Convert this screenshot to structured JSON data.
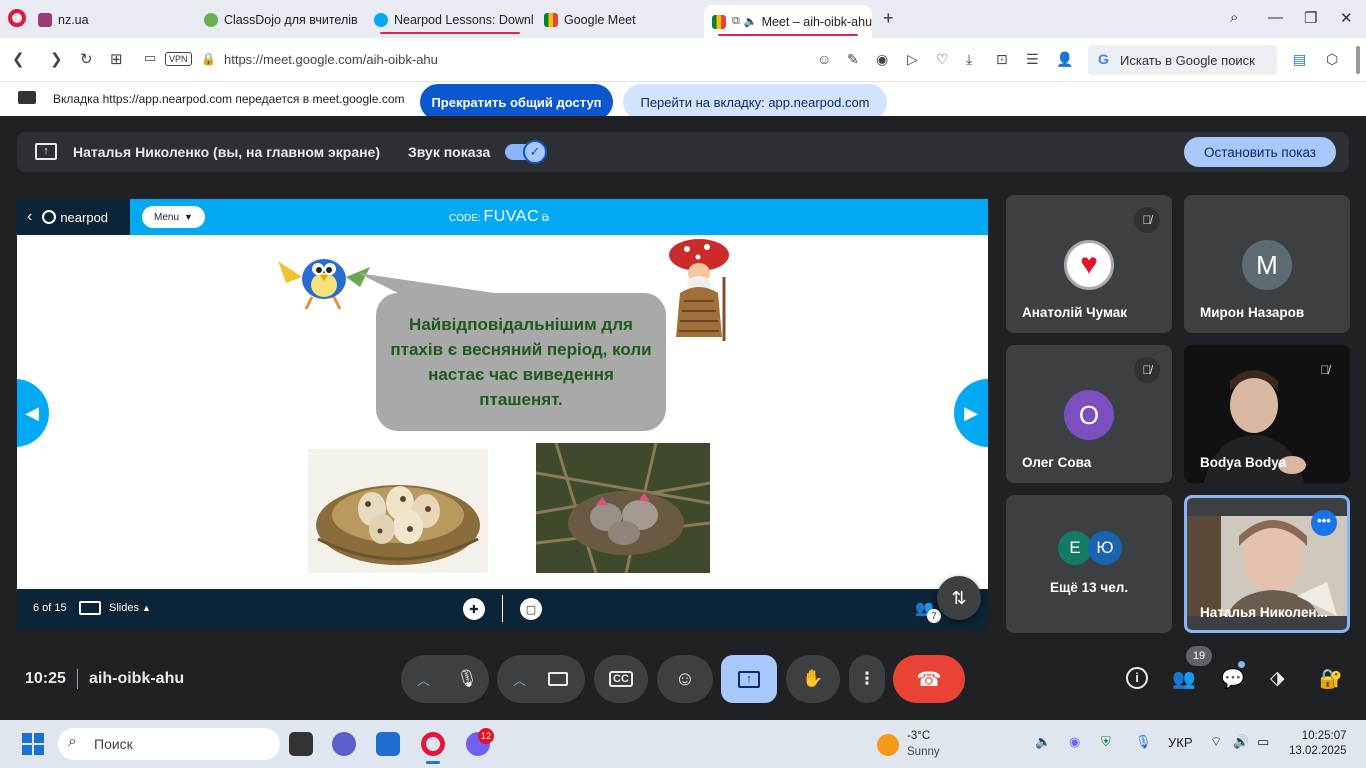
{
  "browser": {
    "tabs": [
      {
        "title": "nz.ua",
        "icon": "nzua-icon"
      },
      {
        "title": "ClassDojo для вчителів",
        "icon": "classdojo-icon"
      },
      {
        "title": "Nearpod Lessons: Downlo",
        "icon": "nearpod-icon"
      },
      {
        "title": "Google Meet",
        "icon": "google-meet-icon"
      },
      {
        "title": "Meet – aih-oibk-ahu",
        "icon": "google-meet-icon"
      }
    ],
    "address": "https://meet.google.com/aih-oibk-ahu",
    "vpn_label": "VPN",
    "search_box": "Искать в Google поиск",
    "share_message": "Вкладка https://app.nearpod.com передается в meet.google.com",
    "stop_sharing_label": "Прекратить общий доступ",
    "go_to_tab_label": "Перейти на вкладку: app.nearpod.com"
  },
  "presentation_bar": {
    "presenter": "Наталья Николенко (вы, на главном экране)",
    "sound_label": "Звук показа",
    "sound_on": true,
    "stop_label": "Остановить показ"
  },
  "nearpod": {
    "brand": "nearpod",
    "menu_label": "Menu",
    "code_prefix": "CODE:",
    "code": "FUVAC",
    "slide_text": "Найвідповідальнішим для птахів є весняний період, коли настає час виведення пташенят.",
    "slide_counter": "6 of 15",
    "slides_label": "Slides",
    "participants_badge": "7",
    "accent": "#03a9f4",
    "dark": "#0b2438"
  },
  "participants": [
    {
      "name": "Анатолій Чумак",
      "avatar": "heart-logo",
      "muted": true
    },
    {
      "name": "Мирон Назаров",
      "initial": "M",
      "color": "#5f6b73",
      "muted": false
    },
    {
      "name": "Олег Сова",
      "initial": "O",
      "color": "#7b4fbf",
      "muted": true
    },
    {
      "name": "Bodya Bodya",
      "video": true,
      "muted": true
    },
    {
      "more_label": "Ещё 13 чел.",
      "initials": [
        "Е",
        "Ю"
      ],
      "colors": [
        "#137a63",
        "#1a63b0"
      ]
    },
    {
      "name": "Наталья Николен...",
      "video": true,
      "self": true
    }
  ],
  "controls": {
    "time": "10:25",
    "meeting_code": "aih-oibk-ahu",
    "participant_count": "19"
  },
  "taskbar": {
    "search_placeholder": "Поиск",
    "weather_temp": "-3°C",
    "weather_desc": "Sunny",
    "viber_badge": "12",
    "language": "УКР",
    "clock_time": "10:25:07",
    "clock_date": "13.02.2025"
  }
}
